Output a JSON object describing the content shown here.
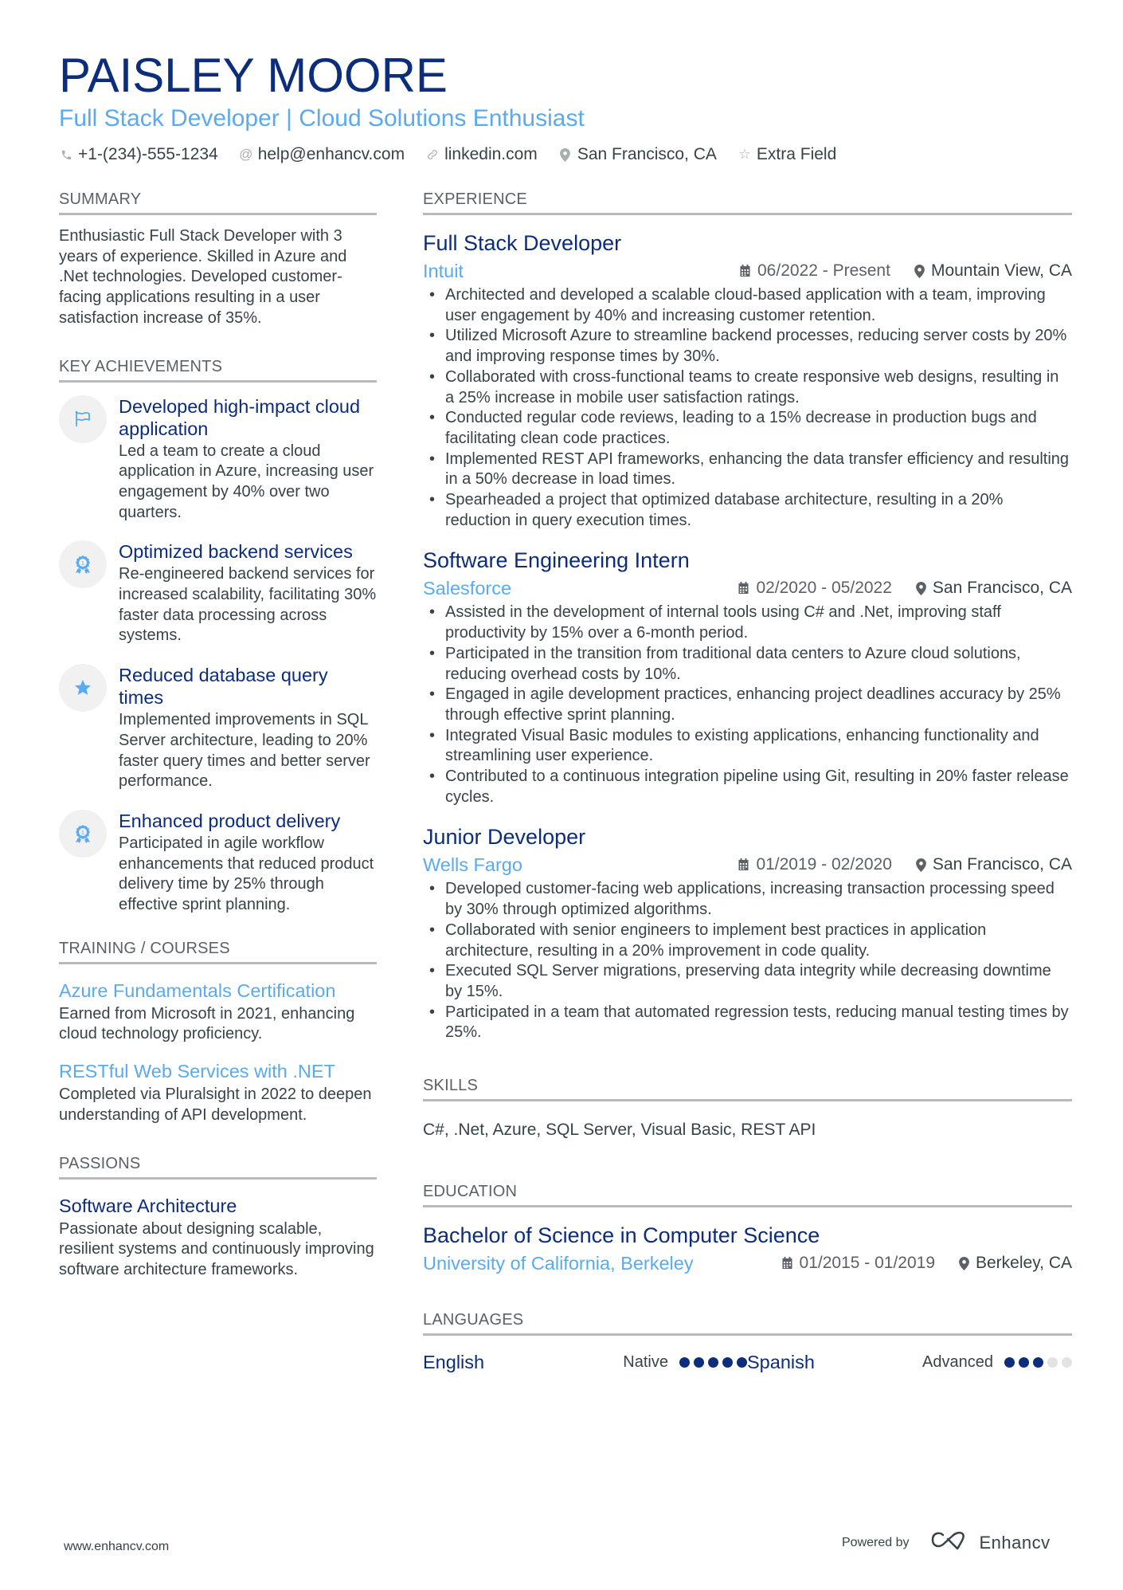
{
  "header": {
    "name": "PAISLEY MOORE",
    "title": "Full Stack Developer | Cloud Solutions Enthusiast",
    "contacts": [
      {
        "icon": "phone-icon",
        "text": "+1-(234)-555-1234"
      },
      {
        "icon": "at-icon",
        "text": "help@enhancv.com"
      },
      {
        "icon": "link-icon",
        "text": "linkedin.com"
      },
      {
        "icon": "location-pin-icon",
        "text": "San Francisco, CA"
      },
      {
        "icon": "star-icon",
        "text": "Extra Field"
      }
    ]
  },
  "summary": {
    "heading": "Summary",
    "text": "Enthusiastic Full Stack Developer with 3 years of experience. Skilled in Azure and .Net technologies. Developed customer-facing applications resulting in a user satisfaction increase of 35%."
  },
  "achievements": {
    "heading": "Key Achievements",
    "items": [
      {
        "icon": "flag-icon",
        "title": "Developed high-impact cloud application",
        "desc": "Led a team to create a cloud application in Azure, increasing user engagement by 40% over two quarters."
      },
      {
        "icon": "award-ribbon-icon",
        "title": "Optimized backend services",
        "desc": "Re-engineered backend services for increased scalability, facilitating 30% faster data processing across systems."
      },
      {
        "icon": "star-icon",
        "title": "Reduced database query times",
        "desc": "Implemented improvements in SQL Server architecture, leading to 20% faster query times and better server performance."
      },
      {
        "icon": "award-ribbon-icon",
        "title": "Enhanced product delivery",
        "desc": "Participated in agile workflow enhancements that reduced product delivery time by 25% through effective sprint planning."
      }
    ]
  },
  "training": {
    "heading": "Training / Courses",
    "items": [
      {
        "title": "Azure Fundamentals Certification",
        "desc": "Earned from Microsoft in 2021, enhancing cloud technology proficiency."
      },
      {
        "title": "RESTful Web Services with .NET",
        "desc": "Completed via Pluralsight in 2022 to deepen understanding of API development."
      }
    ]
  },
  "passions": {
    "heading": "Passions",
    "items": [
      {
        "title": "Software Architecture",
        "desc": "Passionate about designing scalable, resilient systems and continuously improving software architecture frameworks."
      }
    ]
  },
  "experience": {
    "heading": "Experience",
    "jobs": [
      {
        "title": "Full Stack Developer",
        "company": "Intuit",
        "dates": "06/2022 - Present",
        "location": "Mountain View, CA",
        "bullets": [
          "Architected and developed a scalable cloud-based application with a team, improving user engagement by 40% and increasing customer retention.",
          "Utilized Microsoft Azure to streamline backend processes, reducing server costs by 20% and improving response times by 30%.",
          "Collaborated with cross-functional teams to create responsive web designs, resulting in a 25% increase in mobile user satisfaction ratings.",
          "Conducted regular code reviews, leading to a 15% decrease in production bugs and facilitating clean code practices.",
          "Implemented REST API frameworks, enhancing the data transfer efficiency and resulting in a 50% decrease in load times.",
          "Spearheaded a project that optimized database architecture, resulting in a 20% reduction in query execution times."
        ]
      },
      {
        "title": "Software Engineering Intern",
        "company": "Salesforce",
        "dates": "02/2020 - 05/2022",
        "location": "San Francisco, CA",
        "bullets": [
          "Assisted in the development of internal tools using C# and .Net, improving staff productivity by 15% over a 6-month period.",
          "Participated in the transition from traditional data centers to Azure cloud solutions, reducing overhead costs by 10%.",
          "Engaged in agile development practices, enhancing project deadlines accuracy by 25% through effective sprint planning.",
          "Integrated Visual Basic modules to existing applications, enhancing functionality and streamlining user experience.",
          "Contributed to a continuous integration pipeline using Git, resulting in 20% faster release cycles."
        ]
      },
      {
        "title": "Junior Developer",
        "company": "Wells Fargo",
        "dates": "01/2019 - 02/2020",
        "location": "San Francisco, CA",
        "bullets": [
          "Developed customer-facing web applications, increasing transaction processing speed by 30% through optimized algorithms.",
          "Collaborated with senior engineers to implement best practices in application architecture, resulting in a 20% improvement in code quality.",
          "Executed SQL Server migrations, preserving data integrity while decreasing downtime by 15%.",
          "Participated in a team that automated regression tests, reducing manual testing times by 25%."
        ]
      }
    ]
  },
  "skills": {
    "heading": "Skills",
    "text": "C#, .Net, Azure, SQL Server, Visual Basic, REST API"
  },
  "education": {
    "heading": "Education",
    "degree": "Bachelor of Science in Computer Science",
    "school": "University of California, Berkeley",
    "dates": "01/2015 - 01/2019",
    "location": "Berkeley, CA"
  },
  "languages": {
    "heading": "Languages",
    "items": [
      {
        "name": "English",
        "level": "Native",
        "rating": 5,
        "max": 5
      },
      {
        "name": "Spanish",
        "level": "Advanced",
        "rating": 3,
        "max": 5
      }
    ]
  },
  "footer": {
    "website": "www.enhancv.com",
    "powered_by": "Powered by",
    "brand": "Enhancv"
  },
  "colors": {
    "primary": "#0b2d7c",
    "accent": "#5aaaf0",
    "text": "#384347",
    "rule": "#b8bbbe",
    "icon_bg": "#f1f1f2"
  }
}
